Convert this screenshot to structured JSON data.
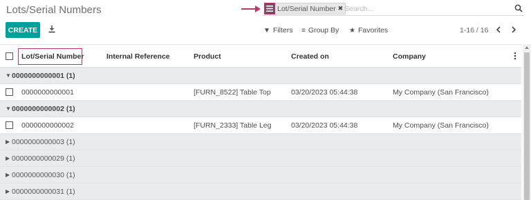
{
  "header": {
    "title": "Lots/Serial Numbers"
  },
  "search": {
    "facet_label": "Lot/Serial Number",
    "facet_remove": "✖",
    "placeholder": "Search..."
  },
  "toolbar": {
    "create_label": "CREATE",
    "filters_label": "Filters",
    "groupby_label": "Group By",
    "favorites_label": "Favorites",
    "pager_text": "1-16 / 16"
  },
  "table": {
    "columns": [
      "Lot/Serial Number",
      "Internal Reference",
      "Product",
      "Created on",
      "Company"
    ],
    "groups": [
      {
        "label": "0000000000001 (1)",
        "expanded": true,
        "rows": [
          {
            "lot": "0000000000001",
            "ref": "",
            "product": "[FURN_8522] Table Top",
            "created": "03/20/2023 05:44:38",
            "company": "My Company (San Francisco)"
          }
        ]
      },
      {
        "label": "0000000000002 (1)",
        "expanded": true,
        "rows": [
          {
            "lot": "0000000000002",
            "ref": "",
            "product": "[FURN_2333] Table Leg",
            "created": "03/20/2023 05:44:38",
            "company": "My Company (San Francisco)"
          }
        ]
      },
      {
        "label": "0000000000003 (1)",
        "expanded": false
      },
      {
        "label": "0000000000029 (1)",
        "expanded": false
      },
      {
        "label": "0000000000030 (1)",
        "expanded": false
      },
      {
        "label": "0000000000031 (1)",
        "expanded": false
      }
    ]
  },
  "colors": {
    "accent": "#00a09d",
    "brand": "#714b67",
    "highlight": "#c0366b"
  }
}
